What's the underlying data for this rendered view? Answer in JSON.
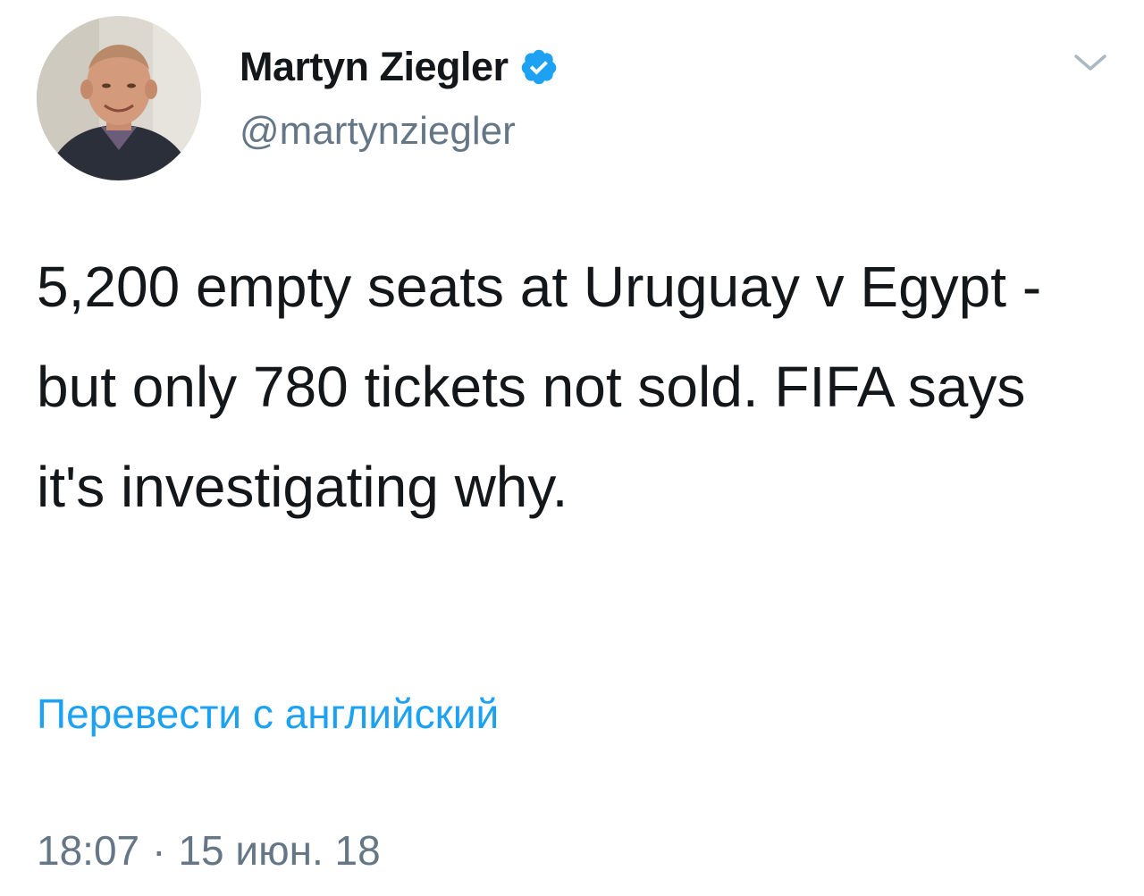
{
  "author": {
    "display_name": "Martyn Ziegler",
    "handle": "@martynziegler",
    "verified": true
  },
  "tweet": {
    "text": "5,200 empty seats at Uruguay v Egypt - but only 780 tickets not sold. FIFA says it's investigating why.",
    "translate_label": "Перевести с английский",
    "time": "18:07",
    "separator": "·",
    "date": "15 июн. 18"
  },
  "icons": {
    "verified": "verified-badge-icon",
    "menu": "chevron-down-icon"
  },
  "colors": {
    "link": "#1da1f2",
    "secondary_text": "#657786",
    "primary_text": "#14171a",
    "verified_badge": "#1da1f2"
  }
}
